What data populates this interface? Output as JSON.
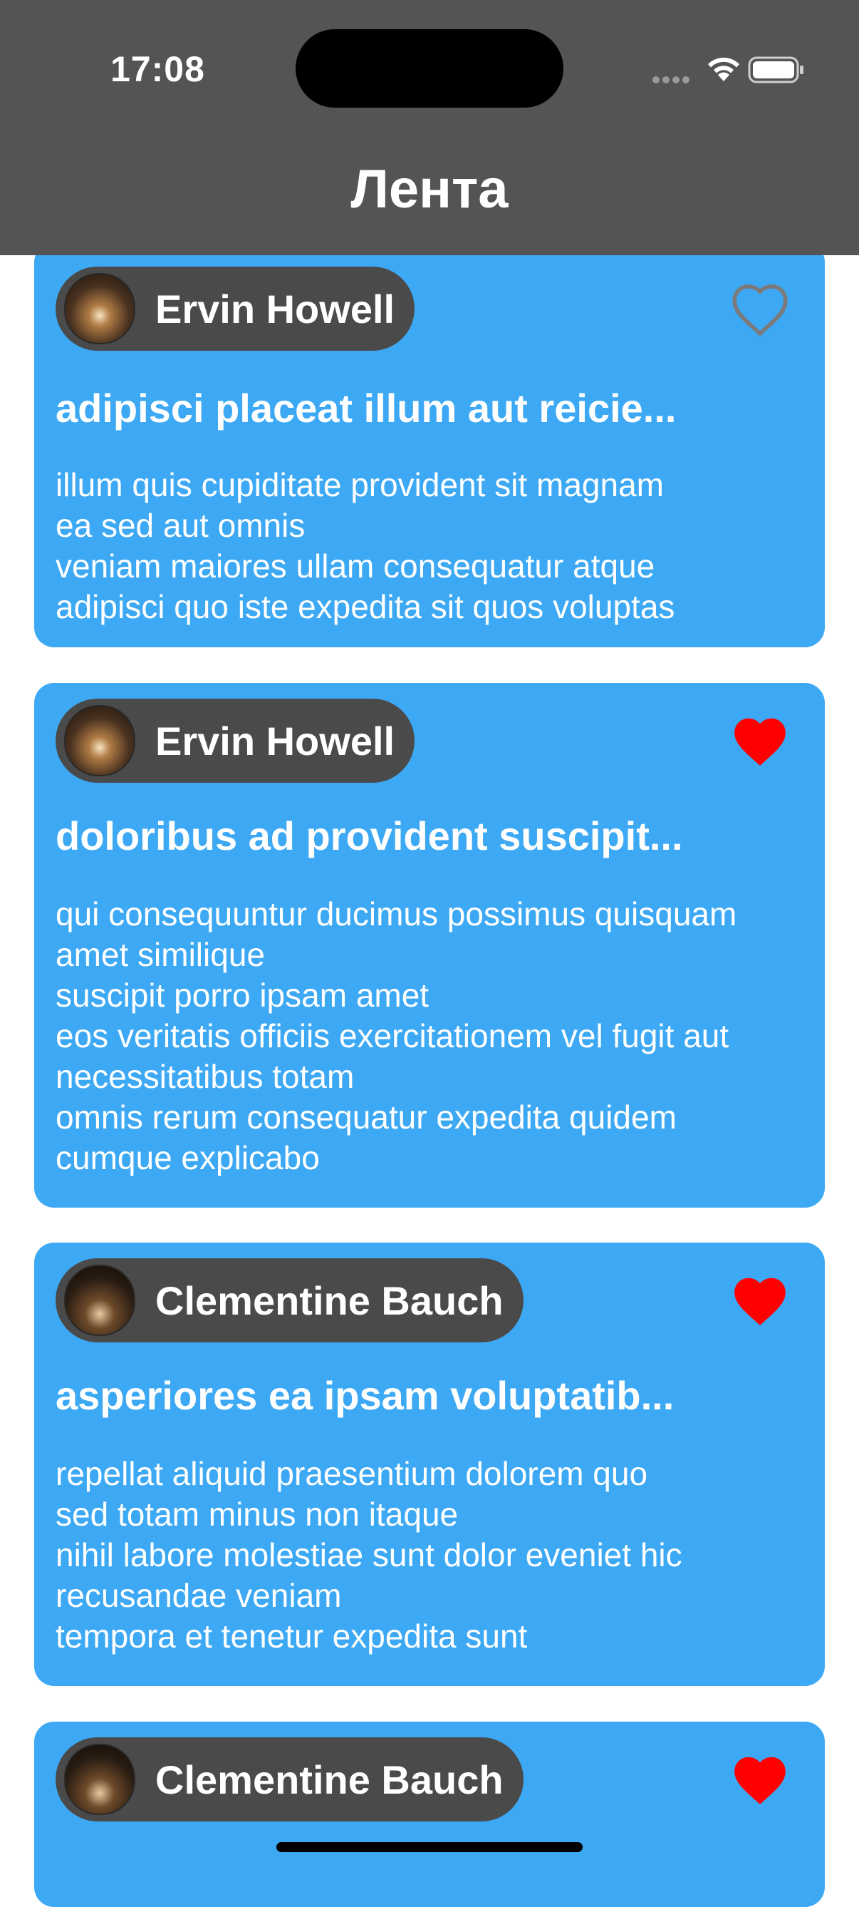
{
  "status_bar": {
    "time": "17:08"
  },
  "header": {
    "title": "Лента"
  },
  "colors": {
    "header_bg": "#545454",
    "card_bg": "#3DA9F4",
    "chip_bg": "#4a4a4a",
    "like_active": "#FF0000",
    "like_inactive": "#7a7a7a"
  },
  "posts": [
    {
      "author": "Ervin Howell",
      "liked": false,
      "title": "adipisci placeat illum aut reicie...",
      "body": "illum quis cupiditate provident sit magnam\nea sed aut omnis\nveniam maiores ullam consequatur atque\nadipisci quo iste expedita sit quos voluptas"
    },
    {
      "author": "Ervin Howell",
      "liked": true,
      "title": "doloribus ad provident suscipit...",
      "body": "qui consequuntur ducimus possimus quisquam\namet similique\nsuscipit porro ipsam amet\neos veritatis officiis exercitationem vel fugit aut\nnecessitatibus totam\nomnis rerum consequatur expedita quidem\ncumque explicabo"
    },
    {
      "author": "Clementine Bauch",
      "liked": true,
      "title": "asperiores ea ipsam voluptatib...",
      "body": "repellat aliquid praesentium dolorem quo\nsed totam minus non itaque\nnihil labore molestiae sunt dolor eveniet hic\nrecusandae veniam\ntempora et tenetur expedita sunt"
    },
    {
      "author": "Clementine Bauch",
      "liked": true,
      "title": "",
      "body": ""
    }
  ]
}
